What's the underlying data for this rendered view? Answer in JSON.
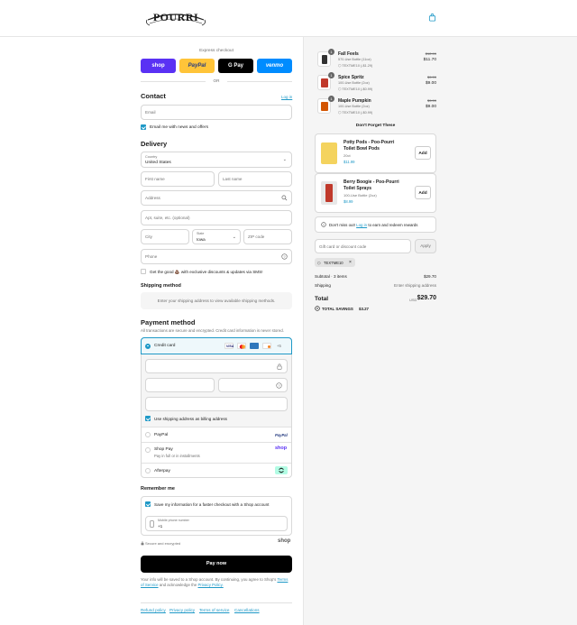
{
  "brand": {
    "logo_text": "POURRI",
    "accent": "#1f99c7"
  },
  "express": {
    "label": "Express checkout",
    "or": "OR",
    "buttons": [
      {
        "label": "shop",
        "color": "#5a31f4"
      },
      {
        "label": "PayPal",
        "color": "#ffc439"
      },
      {
        "label": "G Pay",
        "color": "#000000"
      },
      {
        "label": "venmo",
        "color": "#008cff"
      }
    ]
  },
  "contact": {
    "title": "Contact",
    "login": "Log in",
    "email_placeholder": "Email",
    "newsletter": "Email me with news and offers"
  },
  "delivery": {
    "title": "Delivery",
    "country_label": "Country",
    "country_value": "United States",
    "first_name": "First name",
    "last_name": "Last name",
    "address": "Address",
    "apartment": "Apt, suite, etc. (optional)",
    "city": "City",
    "state_label": "State",
    "state_value": "Iowa",
    "zip": "ZIP code",
    "phone": "Phone",
    "sms": "Get the good 💩 with exclusive discounts & updates via SMS!"
  },
  "shipping": {
    "title": "Shipping method",
    "message": "Enter your shipping address to view available shipping methods."
  },
  "payment": {
    "title": "Payment method",
    "subtitle": "All transactions are secure and encrypted. Credit card information is never stored.",
    "credit_card": "Credit card",
    "card_more": "+5",
    "billing_same": "Use shipping address as billing address",
    "paypal": "PayPal",
    "paypal_logo": "PayPal",
    "shoppay": "Shop Pay",
    "shoppay_sub": "Pay in full or in installments",
    "shoppay_logo": "shop",
    "afterpay": "Afterpay"
  },
  "remember": {
    "title": "Remember me",
    "save_info": "Save my information for a faster checkout with a Shop account",
    "mobile_label": "Mobile phone number",
    "mobile_value": "+1",
    "secure": "Secure and encrypted",
    "shop_logo": "shop"
  },
  "pay_button": "Pay now",
  "legal": {
    "text1": "Your info will be saved to a Shop account. By continuing, you agree to Shop's",
    "terms": "Terms of Service",
    "text2": "and acknowledge the",
    "privacy": "Privacy Policy."
  },
  "footer_links": [
    "Refund policy",
    "Privacy policy",
    "Terms of service",
    "Cancellations"
  ],
  "cart": {
    "items": [
      {
        "qty": "1",
        "name": "Fall Feels",
        "variant": "570-Use Bottle (11oz)",
        "discount": "TEXTME10 (-$1.29)",
        "old_price": "$12.99",
        "price": "$11.70",
        "color": "#333333"
      },
      {
        "qty": "1",
        "name": "Spice Spritz",
        "variant": "100-Use Bottle (2oz)",
        "discount": "TEXTME10 (-$0.99)",
        "old_price": "$9.99",
        "price": "$9.00",
        "color": "#c0392b"
      },
      {
        "qty": "1",
        "name": "Maple Pumpkin",
        "variant": "100-Use Bottle (2oz)",
        "discount": "TEXTME10 (-$0.99)",
        "old_price": "$9.99",
        "price": "$9.00",
        "color": "#d35400"
      }
    ],
    "upsell_title": "Don't Forget These",
    "upsells": [
      {
        "name1": "Potty Pods - Poo-Pourri",
        "name2": "Toilet Bowl Pods",
        "variant": "20ct",
        "price": "$11.99",
        "add": "Add"
      },
      {
        "name1": "Berry Boogie - Poo-Pourri",
        "name2": "Toilet Sprays",
        "variant": "100-Use Bottle (2oz)",
        "price": "$8.99",
        "add": "Add"
      }
    ],
    "rewards_pre": "Don't miss out!",
    "rewards_link": "Log in",
    "rewards_post": "to earn and redeem rewards",
    "discount_placeholder": "Gift card or discount code",
    "apply": "Apply",
    "code_tag": "TEXTME10",
    "subtotal_label": "Subtotal · 3 items",
    "subtotal_value": "$29.70",
    "shipping_label": "Shipping",
    "shipping_value": "Enter shipping address",
    "total_label": "Total",
    "currency": "USD",
    "total_value": "$29.70",
    "savings_label": "TOTAL SAVINGS",
    "savings_value": "$3.27"
  }
}
